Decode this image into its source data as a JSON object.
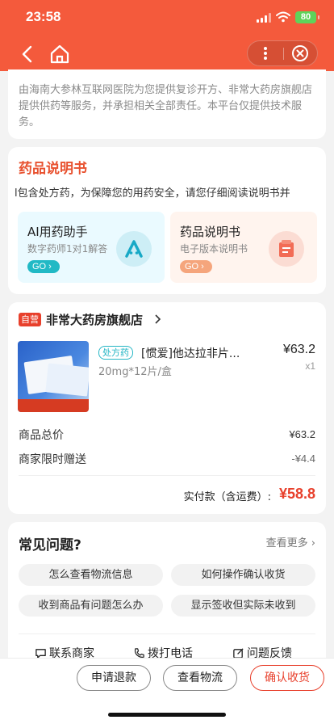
{
  "status_bar": {
    "time": "23:58",
    "battery": "80"
  },
  "notice_card": {
    "text": "由海南大参林互联网医院为您提供复诊开方、非常大药房旗舰店提供供药等服务，并承担相关全部责任。本平台仅提供技术服务。"
  },
  "instructions": {
    "title": "药品说明书",
    "notice": "l包含处方药，为保障您的用药安全，请您仔细阅读说明书并",
    "assistant": {
      "title": "AI用药助手",
      "subtitle": "数字药师1对1解答",
      "go": "GO"
    },
    "manual": {
      "title": "药品说明书",
      "subtitle": "电子版本说明书",
      "go": "GO"
    }
  },
  "order": {
    "self_badge": "自营",
    "store_name": "非常大药房旗舰店",
    "product": {
      "rx_tag": "处方药",
      "name": "[惯爱]他达拉非片...",
      "spec": "20mg*12片/盒",
      "price": "¥63.2",
      "qty": "x1"
    },
    "total_label": "商品总价",
    "total_value": "¥63.2",
    "gift_label": "商家限时赠送",
    "gift_value": "-¥4.4",
    "pay_label": "实付款（含运费）:",
    "pay_value": "¥58.8"
  },
  "faq": {
    "title": "常见问题?",
    "more": "查看更多",
    "questions": [
      "怎么查看物流信息",
      "如何操作确认收货",
      "收到商品有问题怎么办",
      "显示签收但实际未收到"
    ],
    "actions": [
      "联系商家",
      "拨打电话",
      "问题反馈"
    ]
  },
  "bottom_bar": {
    "refund": "申请退款",
    "logistics": "查看物流",
    "confirm": "确认收货"
  },
  "colors": {
    "header": "#f45a3c",
    "accent": "#e8402c",
    "teal": "#21b9c5"
  }
}
